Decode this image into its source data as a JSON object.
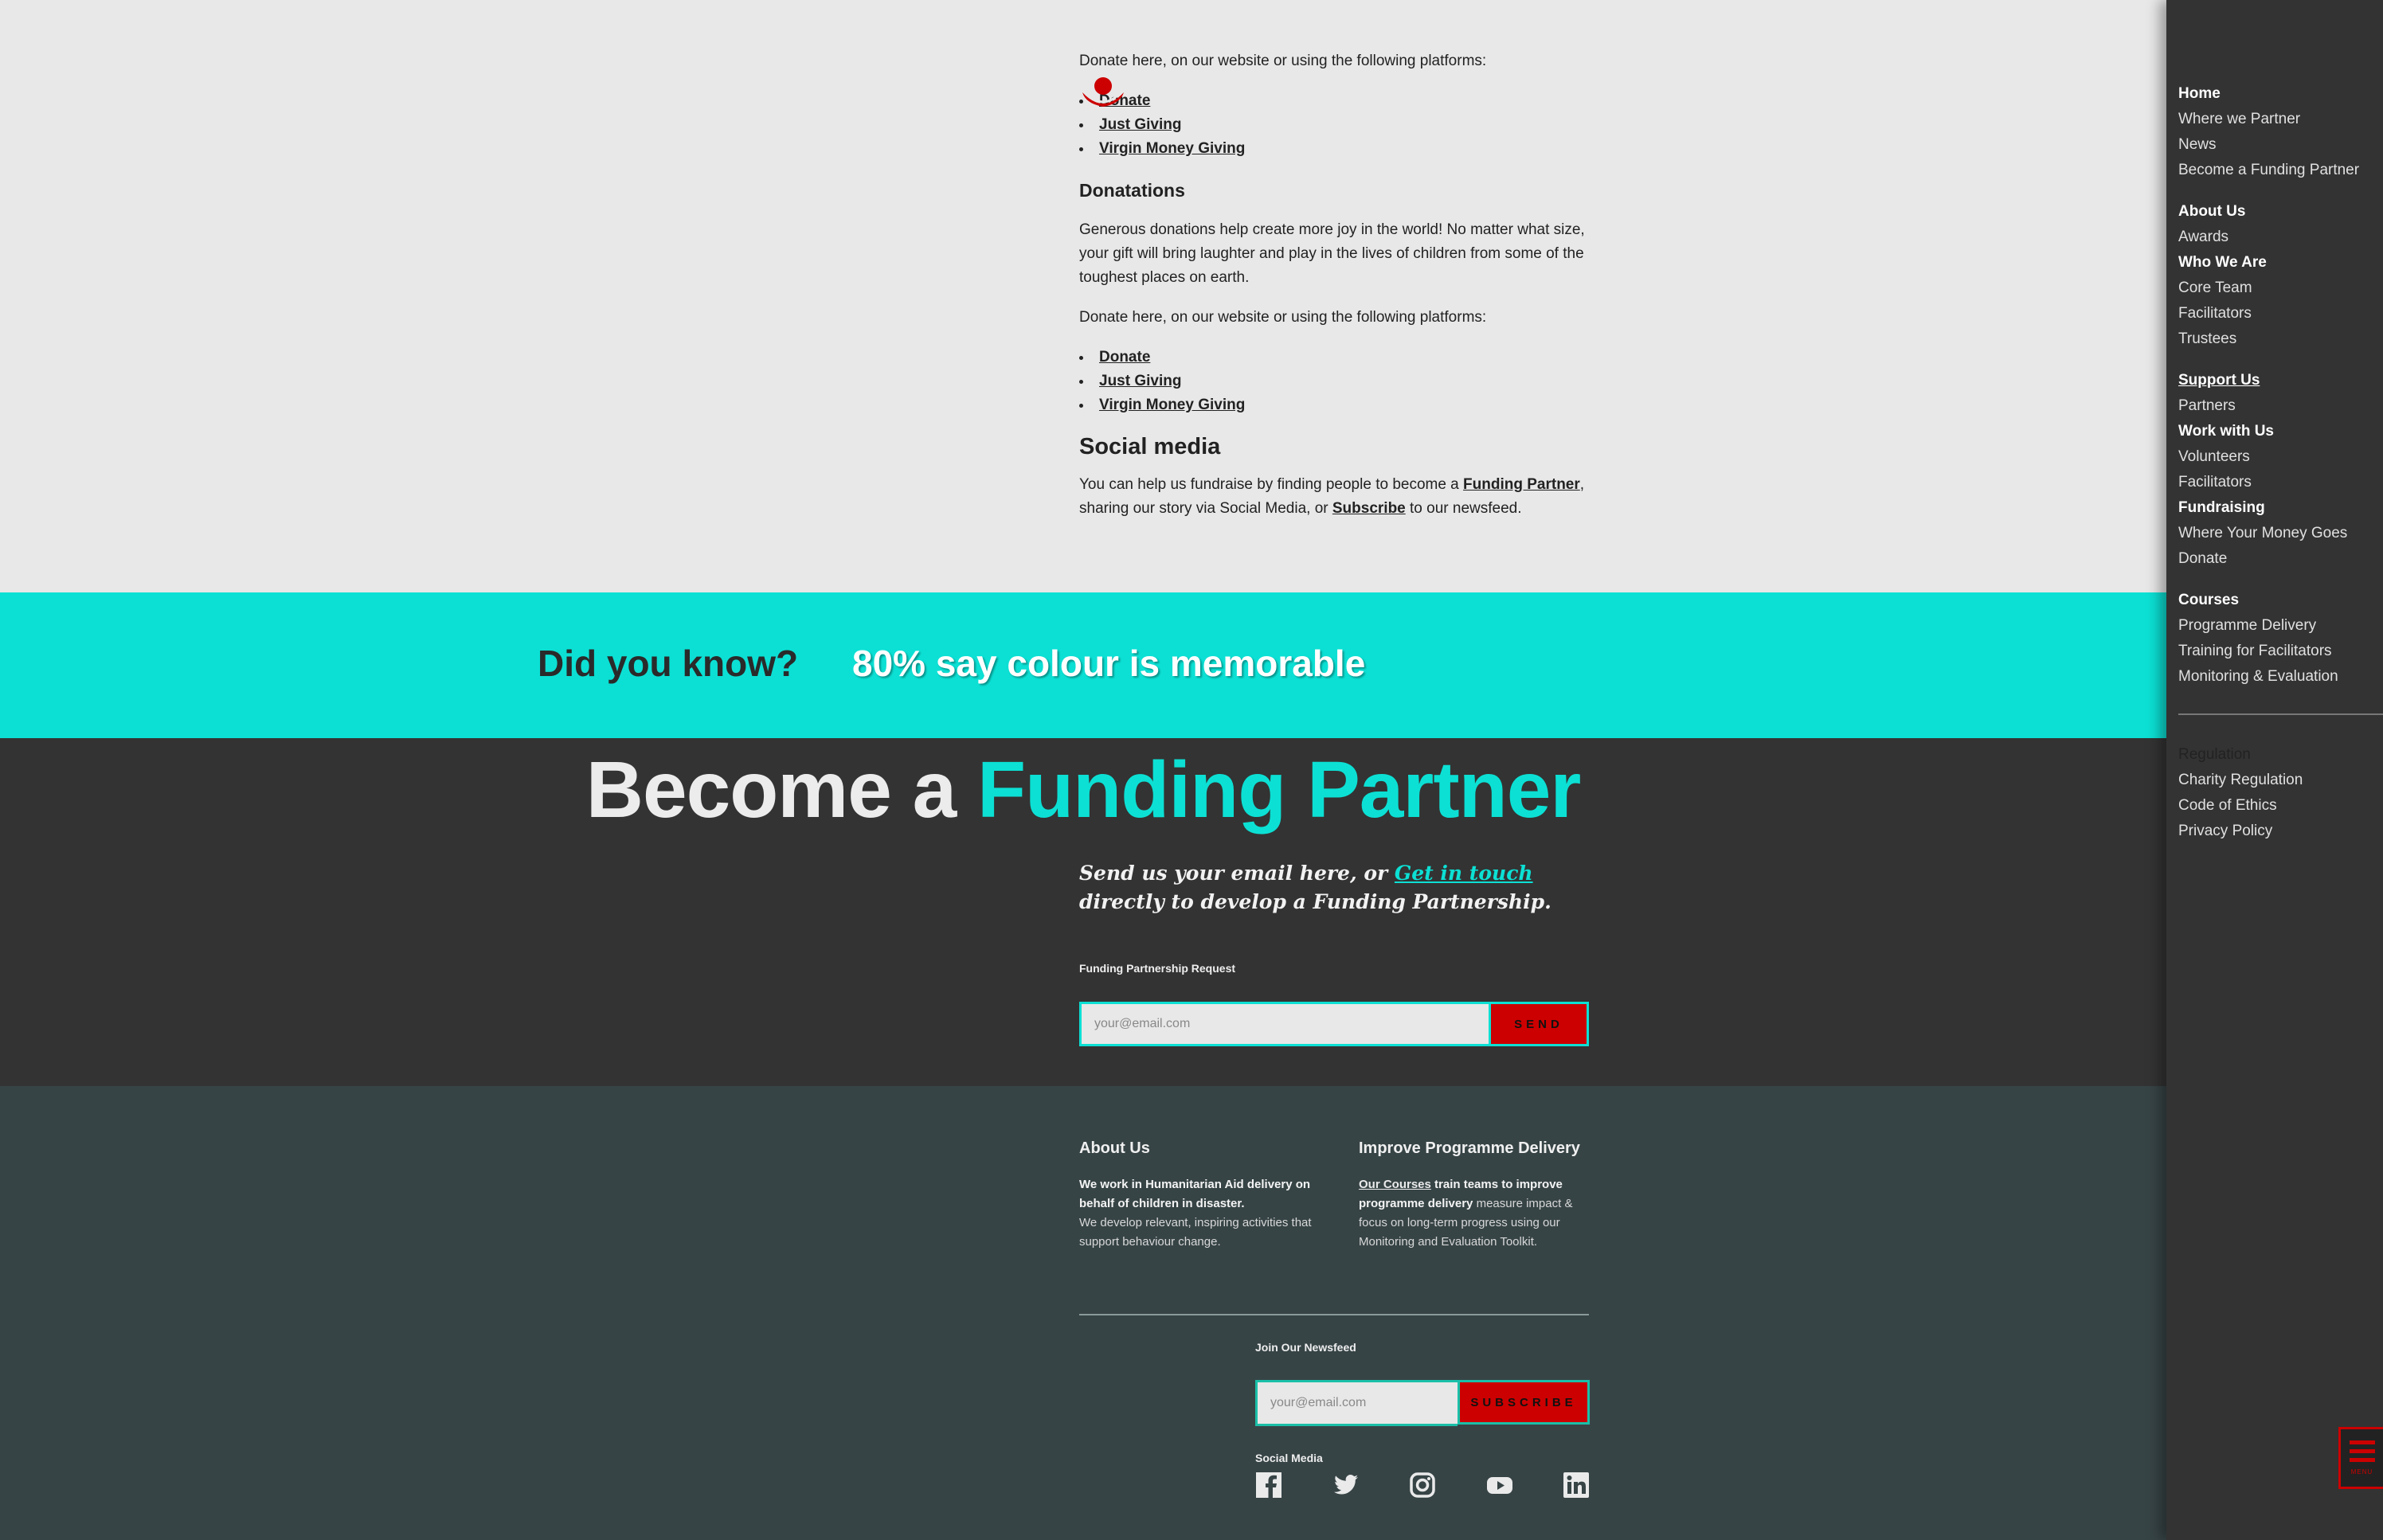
{
  "article": {
    "intro_platforms": "Donate here, on our website or using the following platforms:",
    "list1": [
      "Donate",
      "Just Giving",
      "Virgin Money Giving"
    ],
    "donations_heading": "Donatations",
    "donations_body": "Generous donations help create more joy in the world! No matter what size, your gift will bring laughter and play in the lives of children from some of the toughest places on earth.",
    "platforms_again": "Donate here, on our website or using the following platforms:",
    "list2": [
      "Donate",
      "Just Giving",
      "Virgin Money Giving"
    ],
    "social_heading": "Social media",
    "social_body_1": "You can help us fundraise by finding people to become a ",
    "social_link_1": "Funding Partner",
    "social_body_2": ", sharing our story via Social Media, or ",
    "social_link_2": "Subscribe",
    "social_body_3": " to our newsfeed."
  },
  "banner": {
    "question": "Did you know?",
    "stat": "80% say colour is memorable",
    "bg_color": "#0ce0d4"
  },
  "funding": {
    "title_plain": "Become a ",
    "title_highlight": "Funding Partner",
    "sub_1": "Send us your email here, or ",
    "sub_link": "Get in touch",
    "sub_2": " directly to develop a Funding Partnership.",
    "form_label": "Funding Partnership Request",
    "email_placeholder": "your@email.com",
    "send_label": "SEND"
  },
  "footer": {
    "about_title": "About Us",
    "about_strong": "We work in Humanitarian Aid delivery on behalf of children in disaster.",
    "about_text": "We develop relevant, inspiring activities that support behaviour change.",
    "improve_title": "Improve Programme Delivery",
    "improve_link": "Our Courses",
    "improve_strong": " train teams to improve programme delivery",
    "improve_text": " measure impact & focus on long-term progress using our Monitoring and Evaluation Toolkit.",
    "newsfeed_label": "Join Our Newsfeed",
    "newsfeed_placeholder": "your@email.com",
    "subscribe_label": "SUBSCRIBE",
    "social_label": "Social Media",
    "social_icons": [
      "facebook-icon",
      "twitter-icon",
      "instagram-icon",
      "youtube-icon",
      "linkedin-icon"
    ]
  },
  "sidebar": {
    "groups": [
      {
        "heading": "Home",
        "items": [
          "Where we Partner",
          "News",
          "Become a Funding Partner"
        ]
      },
      {
        "heading": "About Us",
        "items": [
          "Awards"
        ]
      },
      {
        "heading": "Who We Are",
        "items": [
          "Core Team",
          "Facilitators",
          "Trustees"
        ]
      },
      {
        "heading": "Support Us",
        "items": [
          "Partners"
        ]
      },
      {
        "heading": "Work with Us",
        "items": [
          "Volunteers",
          "Facilitators"
        ]
      },
      {
        "heading": "Fundraising",
        "items": [
          "Where Your Money Goes",
          "Donate"
        ]
      },
      {
        "heading": "Courses",
        "items": [
          "Programme Delivery",
          "Training for Facilitators",
          "Monitoring & Evaluation"
        ]
      }
    ],
    "regulation": {
      "heading": "Regulation",
      "items": [
        "Charity Regulation",
        "Code of Ethics",
        "Privacy Policy"
      ]
    },
    "menu_label": "MENU"
  }
}
